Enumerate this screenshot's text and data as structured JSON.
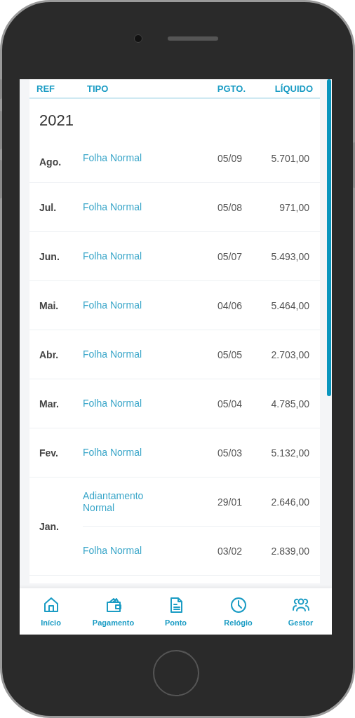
{
  "header": {
    "columns": [
      "REF",
      "TIPO",
      "PGTO.",
      "LÍQUIDO"
    ]
  },
  "year": "2021",
  "months": [
    {
      "month": "Ago.",
      "entries": [
        {
          "type": "Folha Normal",
          "payment": "05/09",
          "net": "5.701,00"
        }
      ]
    },
    {
      "month": "Jul.",
      "entries": [
        {
          "type": "Folha Normal",
          "payment": "05/08",
          "net": "971,00"
        }
      ]
    },
    {
      "month": "Jun.",
      "entries": [
        {
          "type": "Folha Normal",
          "payment": "05/07",
          "net": "5.493,00"
        }
      ]
    },
    {
      "month": "Mai.",
      "entries": [
        {
          "type": "Folha Normal",
          "payment": "04/06",
          "net": "5.464,00"
        }
      ]
    },
    {
      "month": "Abr.",
      "entries": [
        {
          "type": "Folha Normal",
          "payment": "05/05",
          "net": "2.703,00"
        }
      ]
    },
    {
      "month": "Mar.",
      "entries": [
        {
          "type": "Folha Normal",
          "payment": "05/04",
          "net": "4.785,00"
        }
      ]
    },
    {
      "month": "Fev.",
      "entries": [
        {
          "type": "Folha Normal",
          "payment": "05/03",
          "net": "5.132,00"
        }
      ]
    },
    {
      "month": "Jan.",
      "entries": [
        {
          "type": "Adiantamento Normal",
          "payment": "29/01",
          "net": "2.646,00"
        },
        {
          "type": "Folha Normal",
          "payment": "03/02",
          "net": "2.839,00"
        }
      ]
    }
  ],
  "nav": [
    {
      "kind": "home",
      "label": "Início"
    },
    {
      "kind": "wallet",
      "label": "Pagamento"
    },
    {
      "kind": "document",
      "label": "Ponto"
    },
    {
      "kind": "clock",
      "label": "Relógio"
    },
    {
      "kind": "people",
      "label": "Gestor"
    }
  ]
}
